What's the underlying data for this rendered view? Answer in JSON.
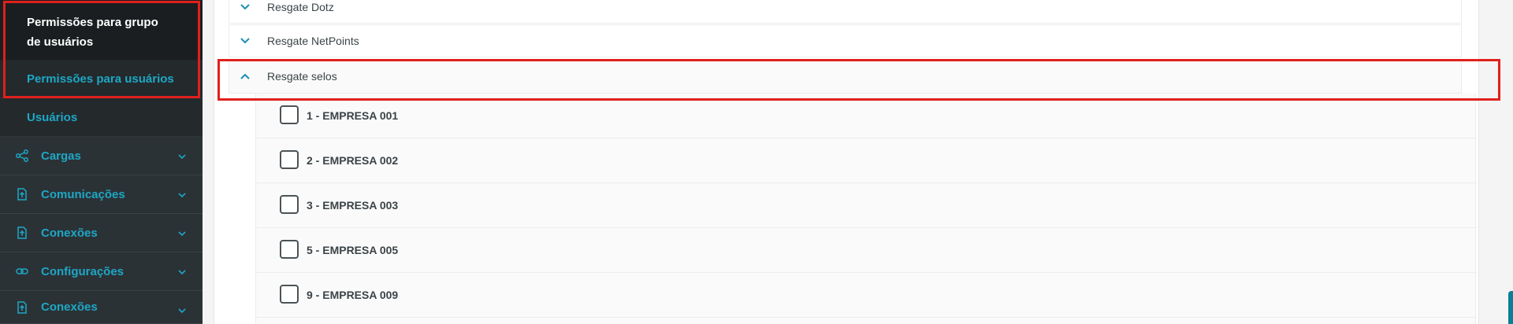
{
  "sidebar": {
    "active_item": "Permissões para grupo de usuários",
    "items": [
      {
        "label": "Permissões para usuários"
      },
      {
        "label": "Usuários"
      }
    ],
    "groups": [
      {
        "label": "Cargas",
        "icon": "share-icon"
      },
      {
        "label": "Comunicações",
        "icon": "file-upload-icon"
      },
      {
        "label": "Conexões",
        "icon": "file-upload-icon"
      },
      {
        "label": "Configurações",
        "icon": "link-icon"
      },
      {
        "label": "Conexões",
        "icon": "file-upload-icon"
      }
    ]
  },
  "accordion": [
    {
      "label": "Resgate Dotz",
      "expanded": false
    },
    {
      "label": "Resgate NetPoints",
      "expanded": false
    },
    {
      "label": "Resgate selos",
      "expanded": true
    }
  ],
  "options": [
    {
      "label": "1 - EMPRESA 001",
      "checked": false
    },
    {
      "label": "2 - EMPRESA 002",
      "checked": false
    },
    {
      "label": "3 - EMPRESA 003",
      "checked": false
    },
    {
      "label": "5 - EMPRESA 005",
      "checked": false
    },
    {
      "label": "9 - EMPRESA 009",
      "checked": false
    }
  ],
  "colors": {
    "accent": "#1ea7c5",
    "highlight": "#e0201c",
    "sidebar_bg": "#24292c"
  }
}
